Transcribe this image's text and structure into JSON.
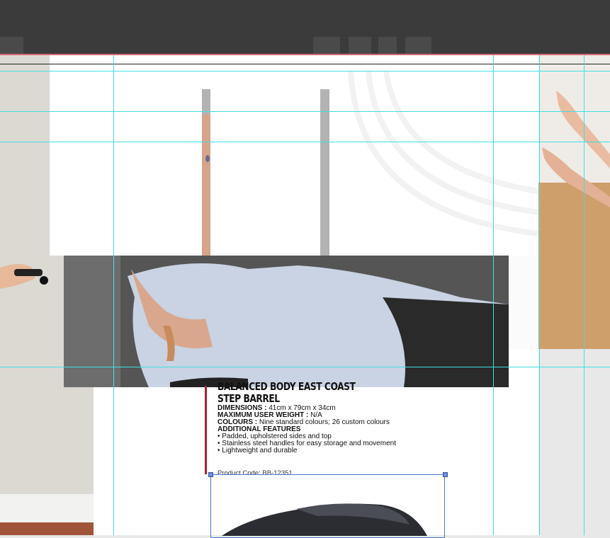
{
  "app": {
    "chrome_color": "#3b3b3b",
    "guide_color": "#3fe0e0",
    "selection_color": "#4a7bd8"
  },
  "product": {
    "title_line1": "BALANCED BODY EAST COAST",
    "title_line2": "STEP BARREL",
    "dimensions_label": "DIMENSIONS :",
    "dimensions_value": " 41cm x 79cm x 34cm",
    "weight_label": "MAXIMUM USER WEIGHT :",
    "weight_value": " N/A",
    "colours_label": "COLOURS :",
    "colours_value": " Nine standard colours; 26 custom colours",
    "features_label": "ADDITIONAL FEATURES",
    "features": [
      "• Padded, upholstered sides and top",
      "• Stainless steel handles for easy storage and movement",
      "• Lightweight and durable"
    ],
    "code": "Product Code: BB-12351",
    "accent_color": "#b01c2e"
  }
}
